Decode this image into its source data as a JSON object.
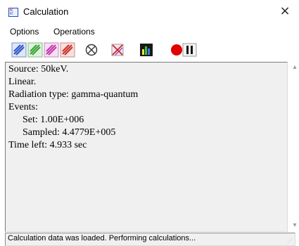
{
  "window": {
    "title": "Calculation",
    "close_label": "×"
  },
  "menu": [
    {
      "label": "Options"
    },
    {
      "label": "Operations"
    }
  ],
  "toolbar": {
    "buttons": [
      {
        "icon": "blue-particles-icon",
        "color": "#2b57c7"
      },
      {
        "icon": "green-particles-icon",
        "color": "#3aa335"
      },
      {
        "icon": "magenta-particles-icon",
        "color": "#c23bb0"
      },
      {
        "icon": "red-particles-icon",
        "color": "#c9342b"
      },
      {
        "icon": "cancel-circle-icon",
        "color": "#333333"
      },
      {
        "icon": "clear-tracks-icon",
        "color": "#cc2a2a"
      },
      {
        "icon": "spectrum-chart-icon",
        "color": "#1a1a1a"
      },
      {
        "icon": "record-icon",
        "color": "#e00000"
      },
      {
        "icon": "pause-icon",
        "color": "#111111"
      }
    ]
  },
  "info": {
    "source": "Source: 50keV.",
    "mode": "Linear.",
    "radiation": "Radiation type: gamma-quantum",
    "events_label": "Events:",
    "set": "Set: 1.00E+006",
    "sampled": "Sampled: 4.4779E+005",
    "time_left": "Time left: 4.933 sec"
  },
  "status": {
    "text": "Calculation data was loaded. Performing calculations..."
  }
}
